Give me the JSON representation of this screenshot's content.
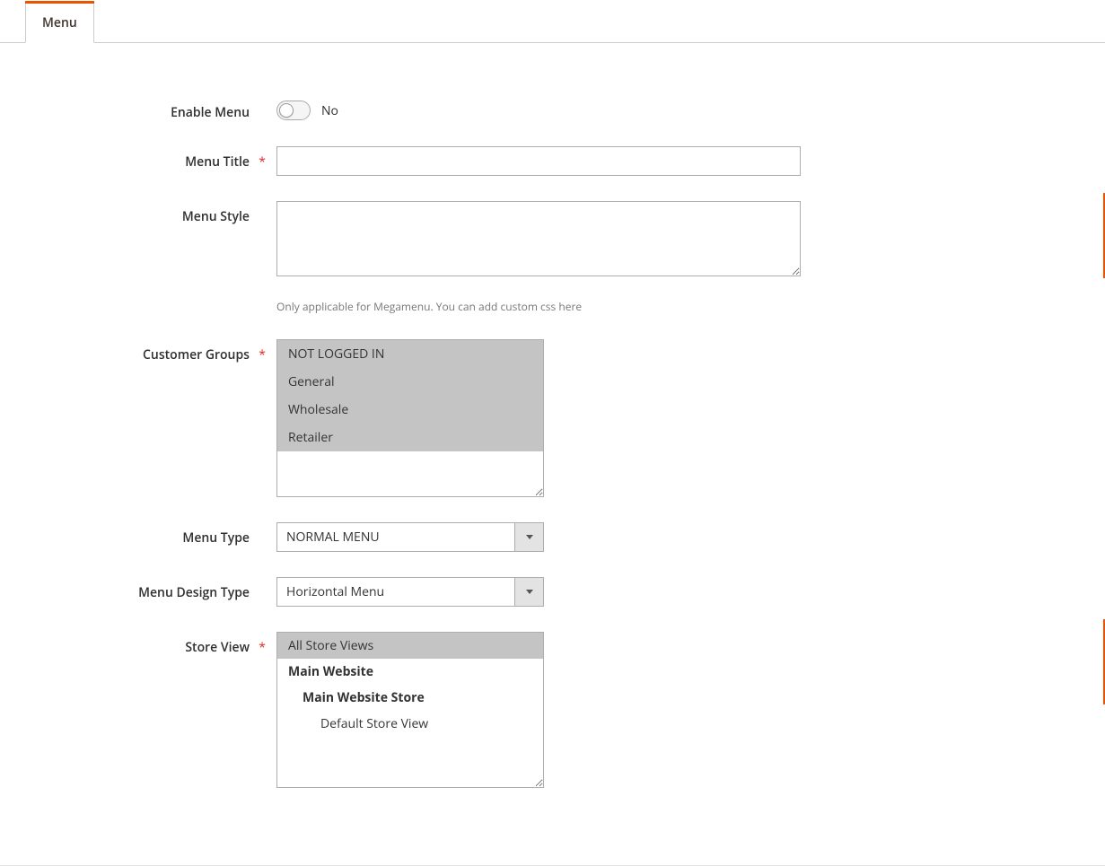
{
  "tab": {
    "label": "Menu"
  },
  "fields": {
    "enable": {
      "label": "Enable Menu",
      "value_text": "No"
    },
    "title": {
      "label": "Menu Title",
      "value": ""
    },
    "style": {
      "label": "Menu Style",
      "value": "",
      "note": "Only applicable for Megamenu. You can add custom css here"
    },
    "groups": {
      "label": "Customer Groups",
      "options": [
        {
          "text": "NOT LOGGED IN",
          "selected": true
        },
        {
          "text": "General",
          "selected": true
        },
        {
          "text": "Wholesale",
          "selected": true
        },
        {
          "text": "Retailer",
          "selected": true
        }
      ]
    },
    "menu_type": {
      "label": "Menu Type",
      "selected": "NORMAL MENU"
    },
    "design_type": {
      "label": "Menu Design Type",
      "selected": "Horizontal Menu"
    },
    "store_view": {
      "label": "Store View",
      "tree": [
        {
          "text": "All Store Views",
          "level": 0,
          "selected": true,
          "bold": false
        },
        {
          "text": "Main Website",
          "level": 1,
          "selected": false,
          "bold": true
        },
        {
          "text": "Main Website Store",
          "level": 2,
          "selected": false,
          "bold": true
        },
        {
          "text": "Default Store View",
          "level": 3,
          "selected": false,
          "bold": false
        }
      ]
    }
  },
  "colors": {
    "accent": "#eb5202",
    "border": "#adadad"
  }
}
